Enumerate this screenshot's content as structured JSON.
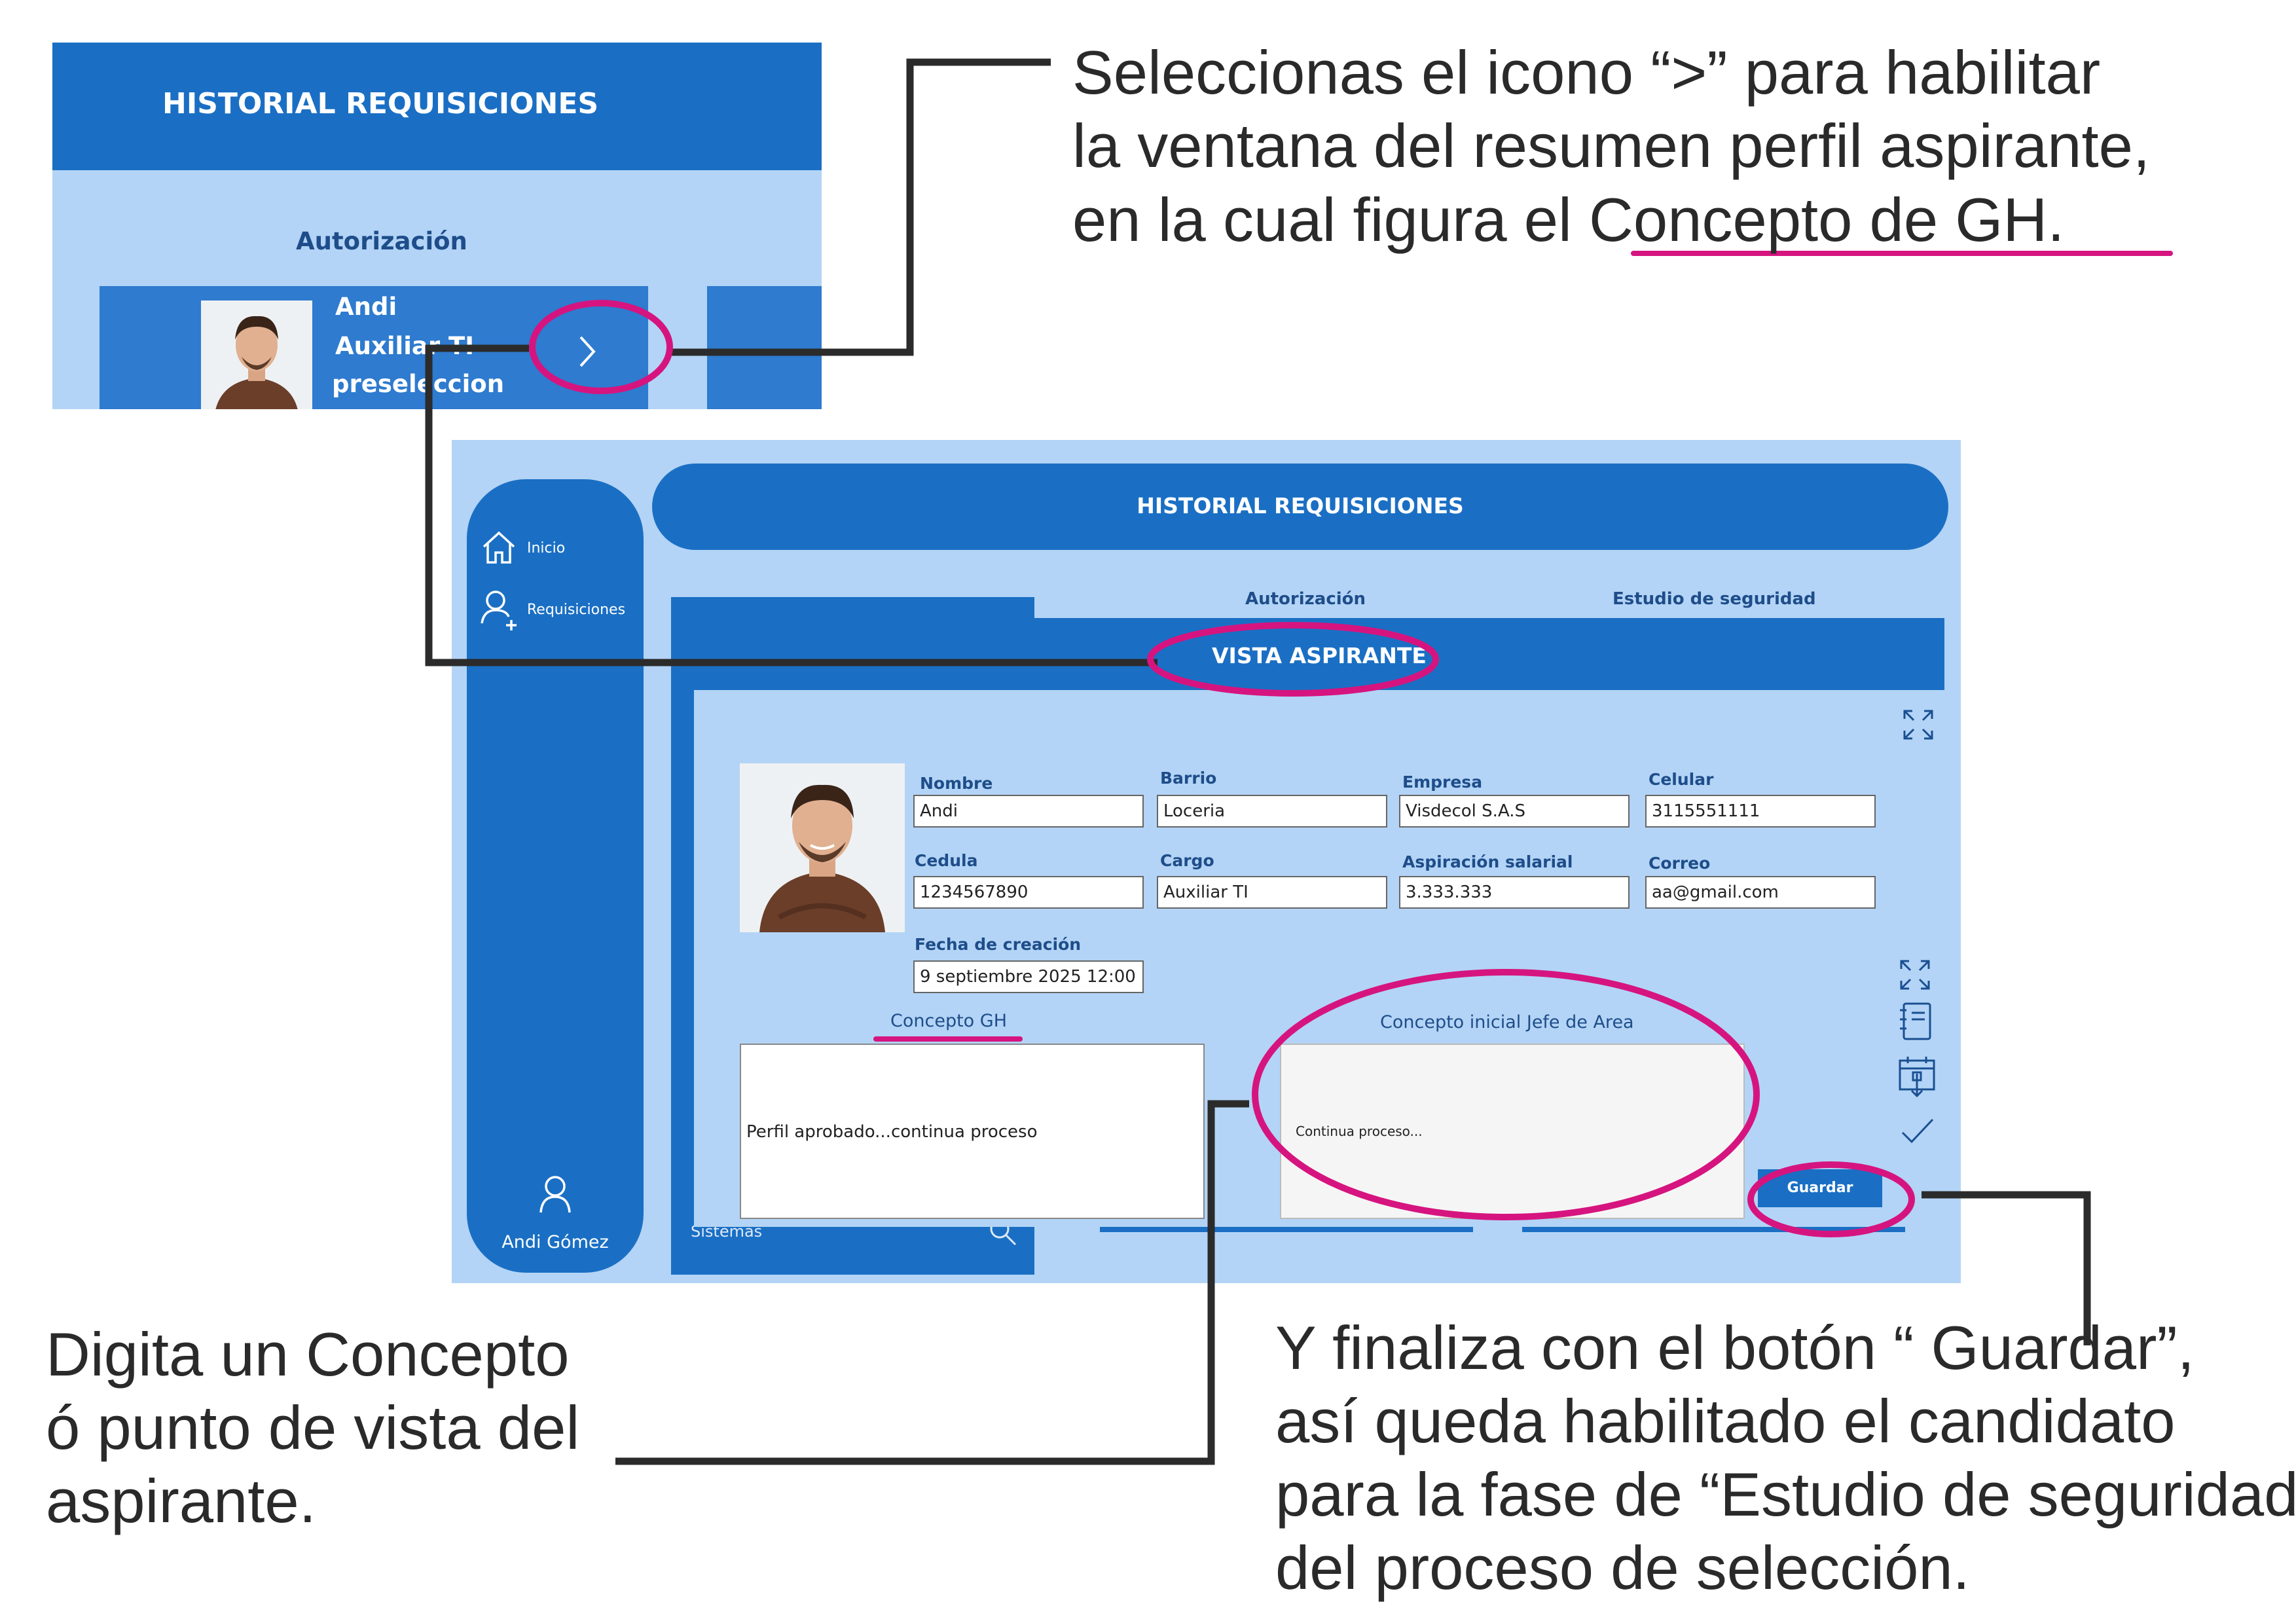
{
  "annotations": {
    "top_right": [
      "Seleccionas el icono “>” para habilitar",
      "la ventana del resumen perfil aspirante,",
      "en la cual figura  el   Concepto  de GH."
    ],
    "bottom_left": [
      "Digita un Concepto",
      "ó punto de vista del",
      "aspirante."
    ],
    "bottom_right": [
      "Y finaliza con el botón “ Guardar”,",
      "así queda habilitado el candidato",
      "para la fase de “Estudio de seguridad”",
      "del proceso de selección."
    ]
  },
  "crop": {
    "title": "HISTORIAL REQUISICIONES",
    "tab": "Autorización",
    "card": {
      "name": "Andi",
      "role": "Auxiliar TI",
      "status": "preseleccion"
    }
  },
  "app": {
    "title": "HISTORIAL REQUISICIONES",
    "sidebar": {
      "items": [
        {
          "label": "Inicio",
          "icon": "home-icon"
        },
        {
          "label": "Requisiciones",
          "icon": "add-user-icon"
        }
      ],
      "user": "Andi Gómez"
    },
    "tabs": [
      "Autorización",
      "Estudio de seguridad"
    ],
    "search_placeholder": "Sistemas",
    "dialog": {
      "title": "VISTA ASPIRANTE",
      "fields": {
        "nombre": {
          "label": "Nombre",
          "value": "Andi"
        },
        "barrio": {
          "label": "Barrio",
          "value": "Loceria"
        },
        "empresa": {
          "label": "Empresa",
          "value": "Visdecol S.A.S"
        },
        "celular": {
          "label": "Celular",
          "value": "3115551111"
        },
        "cedula": {
          "label": "Cedula",
          "value": "1234567890"
        },
        "cargo": {
          "label": "Cargo",
          "value": "Auxiliar TI"
        },
        "aspiracion": {
          "label": "Aspiración salarial",
          "value": "3.333.333"
        },
        "correo": {
          "label": "Correo",
          "value": "aa@gmail.com"
        },
        "fecha": {
          "label": "Fecha de creación",
          "value": "9 septiembre 2025 12:00"
        }
      },
      "concepto_gh": {
        "label": "Concepto GH",
        "value": "Perfil aprobado...continua proceso"
      },
      "concepto_jefe": {
        "label": "Concepto inicial Jefe de Area",
        "value": "Continua proceso..."
      },
      "save_label": "Guardar"
    }
  },
  "colors": {
    "primary": "#1a6fc4",
    "background": "#b3d4f6",
    "highlight": "#d6147f",
    "connector": "#222222"
  }
}
